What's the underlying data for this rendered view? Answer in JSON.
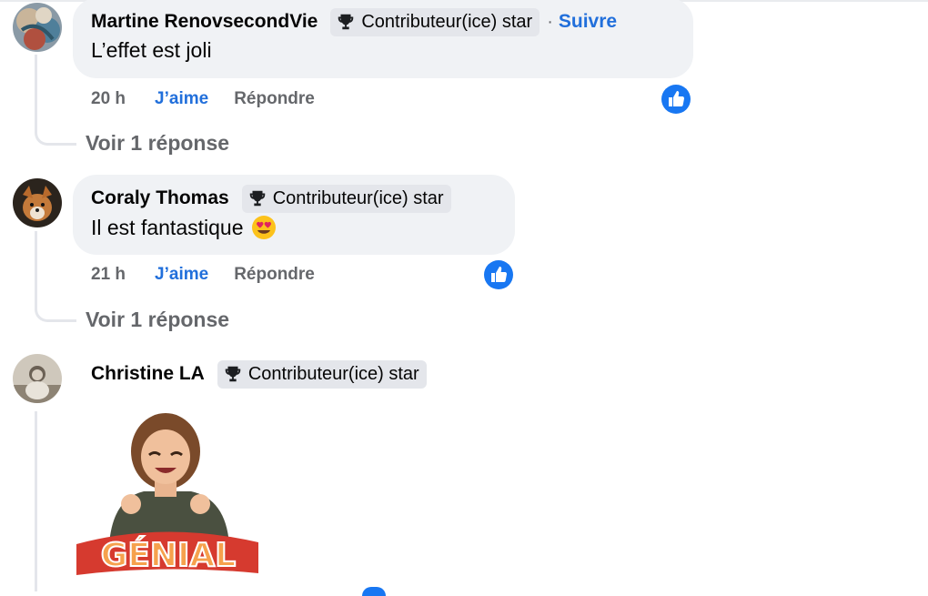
{
  "badge_label": "Contributeur(ice) star",
  "comments": [
    {
      "author": "Martine RenovsecondVie",
      "separator": "·",
      "follow_label": "Suivre",
      "text": "L’effet est joli",
      "time": "20 h",
      "like_label": "J’aime",
      "reply_label": "Répondre",
      "view_replies": "Voir 1 réponse"
    },
    {
      "author": "Coraly Thomas",
      "text": "Il est fantastique",
      "emoji": "heart-eyes-emoji",
      "time": "21 h",
      "like_label": "J’aime",
      "reply_label": "Répondre",
      "view_replies": "Voir 1 réponse"
    },
    {
      "author": "Christine LA",
      "sticker_text": "GÉNIAL"
    }
  ],
  "colors": {
    "accent": "#216fdb",
    "bubble": "#f0f2f5",
    "muted_text": "#65676b",
    "like_badge": "#1877f2"
  }
}
